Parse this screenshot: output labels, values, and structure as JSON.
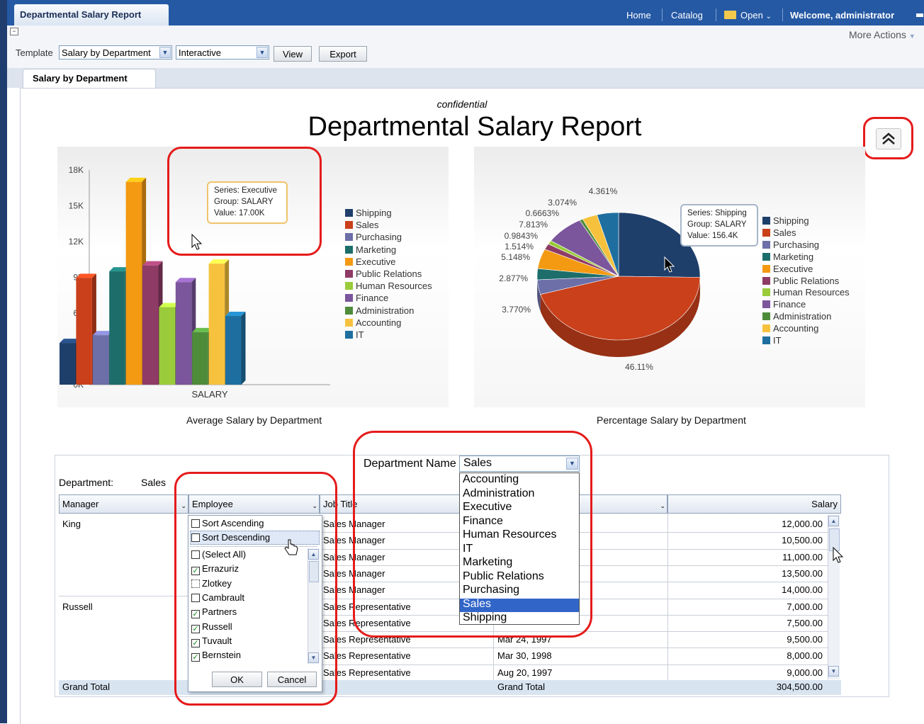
{
  "header": {
    "app_title": "Departmental Salary Report",
    "nav": [
      "Home",
      "Catalog",
      "Open",
      "Welcome, administrator"
    ],
    "more_actions": "More Actions"
  },
  "toolbar": {
    "template_label": "Template",
    "template_value": "Salary by Department",
    "mode_value": "Interactive",
    "view_label": "View",
    "export_label": "Export"
  },
  "tab": {
    "label": "Salary by Department"
  },
  "report": {
    "confidential": "confidential",
    "title": "Departmental Salary Report"
  },
  "chart_data": [
    {
      "type": "bar",
      "title": "Average Salary by Department",
      "xlabel": "SALARY",
      "categories": [
        "SALARY"
      ],
      "ylim": [
        0,
        18000
      ],
      "yticks": [
        "0K",
        "3K",
        "6K",
        "9K",
        "12K",
        "15K",
        "18K"
      ],
      "series": [
        {
          "name": "Shipping",
          "values": [
            3500
          ],
          "color": "#1f3f6b"
        },
        {
          "name": "Sales",
          "values": [
            8950
          ],
          "color": "#c9401b"
        },
        {
          "name": "Purchasing",
          "values": [
            4150
          ],
          "color": "#6c6fa8"
        },
        {
          "name": "Marketing",
          "values": [
            9500
          ],
          "color": "#1d6e6a"
        },
        {
          "name": "Executive",
          "values": [
            17000
          ],
          "color": "#f39a12"
        },
        {
          "name": "Public Relations",
          "values": [
            10000
          ],
          "color": "#8e3b66"
        },
        {
          "name": "Human Resources",
          "values": [
            6500
          ],
          "color": "#9acb3a"
        },
        {
          "name": "Finance",
          "values": [
            8600
          ],
          "color": "#7b569c"
        },
        {
          "name": "Administration",
          "values": [
            4400
          ],
          "color": "#4e8c3a"
        },
        {
          "name": "Accounting",
          "values": [
            10150
          ],
          "color": "#f6c23e"
        },
        {
          "name": "IT",
          "values": [
            5760
          ],
          "color": "#1e6f9f"
        }
      ],
      "tooltip": [
        "Series: Executive",
        "Group: SALARY",
        "Value: 17.00K"
      ]
    },
    {
      "type": "pie",
      "title": "Percentage Salary by Department",
      "slices": [
        {
          "name": "Shipping",
          "value": 25.8,
          "color": "#1f3f6b",
          "label": ""
        },
        {
          "name": "Sales",
          "value": 46.11,
          "color": "#c9401b",
          "label": "46.11%"
        },
        {
          "name": "Purchasing",
          "value": 3.77,
          "color": "#6c6fa8",
          "label": "3.770%"
        },
        {
          "name": "Marketing",
          "value": 2.877,
          "color": "#1d6e6a",
          "label": "2.877%"
        },
        {
          "name": "Executive",
          "value": 5.148,
          "color": "#f39a12",
          "label": "5.148%"
        },
        {
          "name": "Public Relations",
          "value": 1.514,
          "color": "#8e3b66",
          "label": "1.514%"
        },
        {
          "name": "Human Resources",
          "value": 0.9843,
          "color": "#9acb3a",
          "label": "0.9843%"
        },
        {
          "name": "Finance",
          "value": 7.813,
          "color": "#7b569c",
          "label": "7.813%"
        },
        {
          "name": "Administration",
          "value": 0.6663,
          "color": "#4e8c3a",
          "label": "0.6663%"
        },
        {
          "name": "Accounting",
          "value": 3.074,
          "color": "#f6c23e",
          "label": "3.074%"
        },
        {
          "name": "IT",
          "value": 4.361,
          "color": "#1e6f9f",
          "label": "4.361%"
        }
      ],
      "tooltip": [
        "Series: Shipping",
        "Group: SALARY",
        "Value: 156.4K"
      ]
    }
  ],
  "table": {
    "filter_label": "Department Name",
    "filter_value": "Sales",
    "department_label": "Department:",
    "department_value": "Sales",
    "columns": [
      "Manager",
      "Employee",
      "Job Title",
      "",
      "Salary"
    ],
    "rows": [
      {
        "manager": "King",
        "job": "Sales Manager",
        "hire": "",
        "salary": "12,000.00"
      },
      {
        "manager": "",
        "job": "Sales Manager",
        "hire": "",
        "salary": "10,500.00"
      },
      {
        "manager": "",
        "job": "Sales Manager",
        "hire": "",
        "salary": "11,000.00"
      },
      {
        "manager": "",
        "job": "Sales Manager",
        "hire": "",
        "salary": "13,500.00"
      },
      {
        "manager": "",
        "job": "Sales Manager",
        "hire": "",
        "salary": "14,000.00"
      },
      {
        "manager": "Russell",
        "job": "Sales Representative",
        "hire": "",
        "salary": "7,000.00"
      },
      {
        "manager": "",
        "job": "Sales Representative",
        "hire": "",
        "salary": "7,500.00"
      },
      {
        "manager": "",
        "job": "Sales Representative",
        "hire": "Mar 24, 1997",
        "salary": "9,500.00"
      },
      {
        "manager": "",
        "job": "Sales Representative",
        "hire": "Mar 30, 1998",
        "salary": "8,000.00"
      },
      {
        "manager": "",
        "job": "Sales Representative",
        "hire": "Aug 20, 1997",
        "salary": "9,000.00"
      }
    ],
    "grand_total_label": "Grand Total",
    "grand_total_label2": "Grand Total",
    "grand_total_value": "304,500.00"
  },
  "department_dropdown": {
    "options": [
      "Accounting",
      "Administration",
      "Executive",
      "Finance",
      "Human Resources",
      "IT",
      "Marketing",
      "Public Relations",
      "Purchasing",
      "Sales",
      "Shipping"
    ],
    "selected": "Sales"
  },
  "employee_filter": {
    "sort_asc": "Sort Ascending",
    "sort_desc": "Sort Descending",
    "items": [
      {
        "label": "(Select All)",
        "checked": false
      },
      {
        "label": "Errazuriz",
        "checked": true
      },
      {
        "label": "Zlotkey",
        "checked": false
      },
      {
        "label": "Cambrault",
        "checked": false
      },
      {
        "label": "Partners",
        "checked": true
      },
      {
        "label": "Russell",
        "checked": true
      },
      {
        "label": "Tuvault",
        "checked": true
      },
      {
        "label": "Bernstein",
        "checked": true
      }
    ],
    "ok_label": "OK",
    "cancel_label": "Cancel"
  },
  "colors": {
    "highlight": "#e51b1b",
    "header_blue": "#2559a4",
    "selected_option": "#3165c8"
  }
}
